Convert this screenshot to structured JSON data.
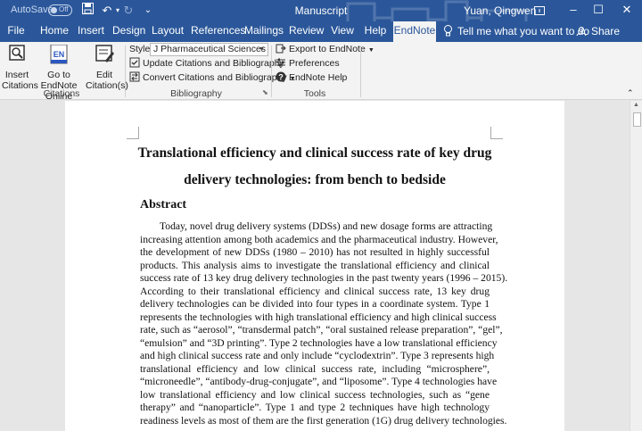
{
  "titlebar": {
    "autosave_label": "AutoSave",
    "autosave_state": "Off",
    "document_title": "Manuscript",
    "user_name": "Yuan, Qingwen"
  },
  "tabs": [
    {
      "label": "File"
    },
    {
      "label": "Home"
    },
    {
      "label": "Insert"
    },
    {
      "label": "Design"
    },
    {
      "label": "Layout"
    },
    {
      "label": "References"
    },
    {
      "label": "Mailings"
    },
    {
      "label": "Review"
    },
    {
      "label": "View"
    },
    {
      "label": "Help"
    },
    {
      "label": "EndNote"
    }
  ],
  "active_tab": "EndNote",
  "tell_me": "Tell me what you want to do",
  "share": "Share",
  "ribbon": {
    "citations": {
      "insert_label_1": "Insert",
      "insert_label_2": "Citations",
      "goto_label_1": "Go to EndNote",
      "goto_label_2": "Online",
      "edit_label_1": "Edit",
      "edit_label_2": "Citation(s)",
      "group_label": "Citations"
    },
    "bibliography": {
      "style_label": "Style:",
      "style_value": "J Pharmaceutical Sciences",
      "update_label": "Update Citations and Bibliography",
      "convert_label": "Convert Citations and Bibliography",
      "group_label": "Bibliography"
    },
    "tools": {
      "export_label": "Export to EndNote",
      "preferences_label": "Preferences",
      "help_label": "EndNote Help",
      "group_label": "Tools"
    }
  },
  "document": {
    "title_line1": "Translational efficiency and clinical success rate of key drug",
    "title_line2": "delivery technologies: from bench to bedside",
    "abstract_heading": "Abstract",
    "abstract_lines": [
      "Today, novel drug delivery systems (DDSs) and new dosage forms are attracting",
      "increasing attention among both academics and the pharmaceutical industry. However,",
      "the development of new DDSs (1980 – 2010) has not resulted in highly successful",
      "products. This analysis aims to investigate the translational efficiency and clinical",
      "success rate of 13 key drug delivery technologies in the past twenty years (1996 – 2015).",
      "According to their translational efficiency and clinical success rate, 13 key drug",
      "delivery technologies can be divided into four types in a coordinate system. Type 1",
      "represents the technologies with high translational efficiency and high clinical success",
      "rate, such as “aerosol”, “transdermal patch”, “oral sustained release preparation”, “gel”,",
      "“emulsion” and “3D printing”. Type 2 technologies have a low translational efficiency",
      "and high clinical success rate and only include “cyclodextrin”. Type 3 represents high",
      "translational efficiency and low clinical success rate, including “microsphere”,",
      "“microneedle”, “antibody-drug-conjugate”, and “liposome”. Type 4 technologies have",
      "low translational efficiency and low clinical success technologies, such as “gene",
      "therapy” and “nanoparticle”. Type 1 and type 2 techniques have high technology",
      "readiness levels as most of them are the first generation (1G) drug delivery technologies."
    ]
  },
  "colors": {
    "brand": "#2b579a",
    "ribbon_bg": "#f3f3f3",
    "canvas": "#e6e6e6"
  }
}
